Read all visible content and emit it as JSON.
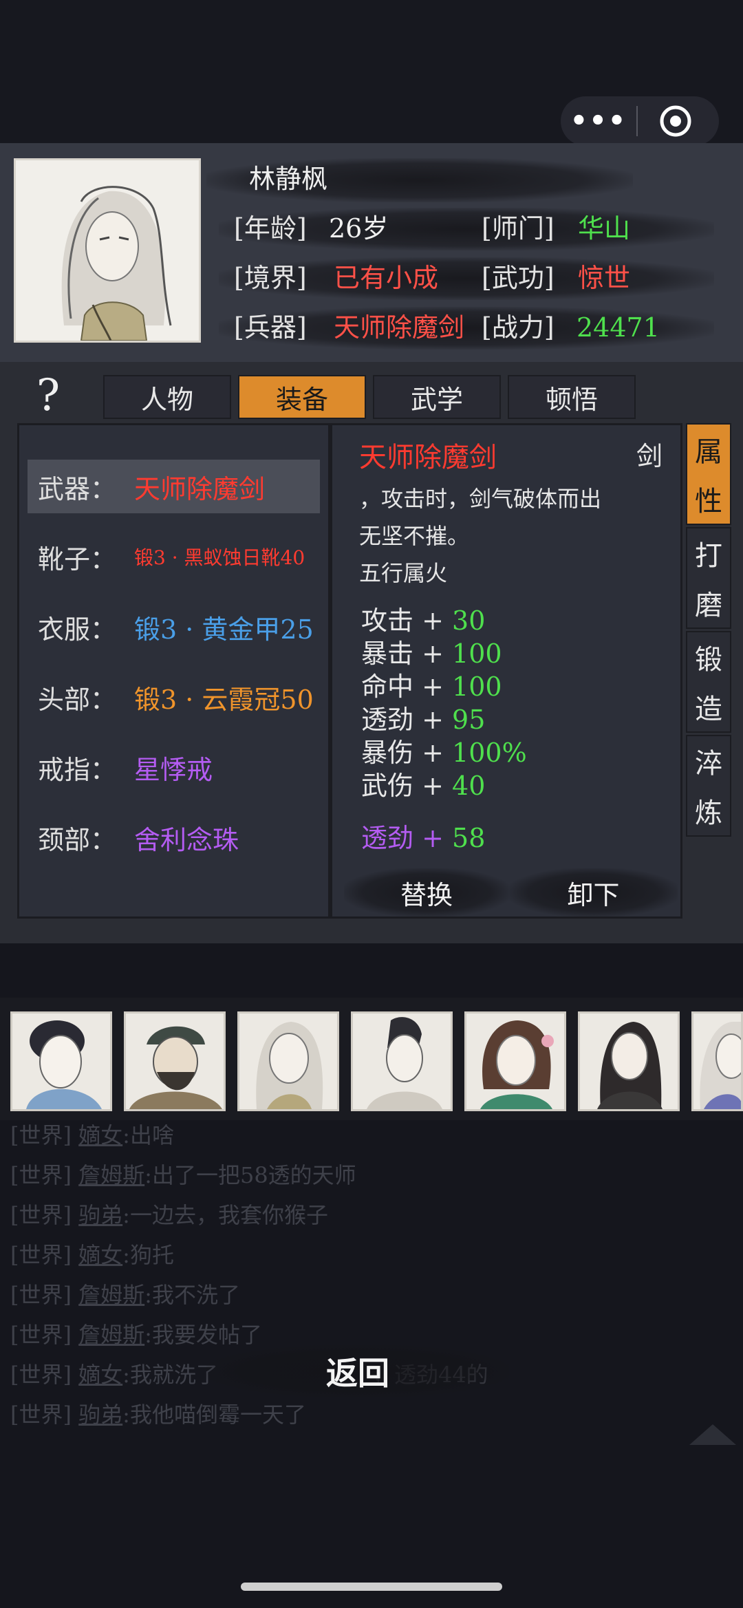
{
  "capsule": {
    "more_label": "•••"
  },
  "character": {
    "name": "林静枫",
    "rows": [
      {
        "label": "[年龄]",
        "value": "26岁",
        "value_color": "white"
      },
      {
        "label": "[师门]",
        "value": "华山",
        "value_color": "green"
      },
      {
        "label": "[境界]",
        "value": "已有小成",
        "value_color": "red"
      },
      {
        "label": "[武功]",
        "value": "惊世",
        "value_color": "red"
      },
      {
        "label": "[兵器]",
        "value": "天师除魔剑",
        "value_color": "red"
      },
      {
        "label": "[战力]",
        "value": "24471",
        "value_color": "green"
      }
    ]
  },
  "help_label": "?",
  "tabs": [
    "人物",
    "装备",
    "武学",
    "顿悟"
  ],
  "active_tab": "装备",
  "equipment": [
    {
      "label": "武器：",
      "item": "天师除魔剑",
      "color": "#ff3b30"
    },
    {
      "label": "靴子：",
      "item": "锻3 · 黑蚁蚀日靴40",
      "color": "#ff3b30"
    },
    {
      "label": "衣服：",
      "item": "锻3 · 黄金甲25",
      "color": "#4a9fe8"
    },
    {
      "label": "头部：",
      "item": "锻3 · 云霞冠50",
      "color": "#f0942b"
    },
    {
      "label": "戒指：",
      "item": "星悸戒",
      "color": "#b45cf2"
    },
    {
      "label": "颈部：",
      "item": "舍利念珠",
      "color": "#b45cf2"
    }
  ],
  "detail": {
    "name": "天师除魔剑",
    "type": "剑",
    "desc_lines": [
      "，攻击时，剑气破体而出",
      "无坚不摧。",
      "五行属火"
    ],
    "stats": [
      {
        "name": "攻击",
        "plus": "+",
        "value": "30"
      },
      {
        "name": "暴击",
        "plus": "+",
        "value": "100"
      },
      {
        "name": "命中",
        "plus": "+",
        "value": "100"
      },
      {
        "name": "透劲",
        "plus": "+",
        "value": "95"
      },
      {
        "name": "暴伤",
        "plus": "+",
        "value": "100%"
      },
      {
        "name": "武伤",
        "plus": "+",
        "value": "40"
      }
    ],
    "bonus": {
      "name": "透劲",
      "plus": "+",
      "value": "58"
    },
    "replace_label": "替换",
    "unequip_label": "卸下"
  },
  "side_tabs": [
    {
      "top": "属",
      "bottom": "性"
    },
    {
      "top": "打",
      "bottom": "磨"
    },
    {
      "top": "锻",
      "bottom": "造"
    },
    {
      "top": "淬",
      "bottom": "炼"
    }
  ],
  "chat": [
    {
      "channel": "[世界]",
      "user": "嫡女",
      "msg": ":出啥"
    },
    {
      "channel": "[世界]",
      "user": "詹姆斯",
      "msg": ":出了一把58透的天师"
    },
    {
      "channel": "[世界]",
      "user": "驹弟",
      "msg": ":一边去，我套你猴子"
    },
    {
      "channel": "[世界]",
      "user": "嫡女",
      "msg": ":狗托"
    },
    {
      "channel": "[世界]",
      "user": "詹姆斯",
      "msg": ":我不洗了"
    },
    {
      "channel": "[世界]",
      "user": "詹姆斯",
      "msg": ":我要发帖了"
    },
    {
      "channel": "[世界]",
      "user": "嫡女",
      "msg": ":我就洗了　　　　　　　，透劲44的"
    },
    {
      "channel": "[世界]",
      "user": "驹弟",
      "msg": ":我他喵倒霉一天了"
    }
  ],
  "back_label": "返回",
  "colors": {
    "accent": "#dd8b2c",
    "red": "#ff5148",
    "green": "#4fe04d",
    "blue": "#4a9fe8",
    "orange": "#f0942b",
    "purple": "#b45cf2"
  }
}
